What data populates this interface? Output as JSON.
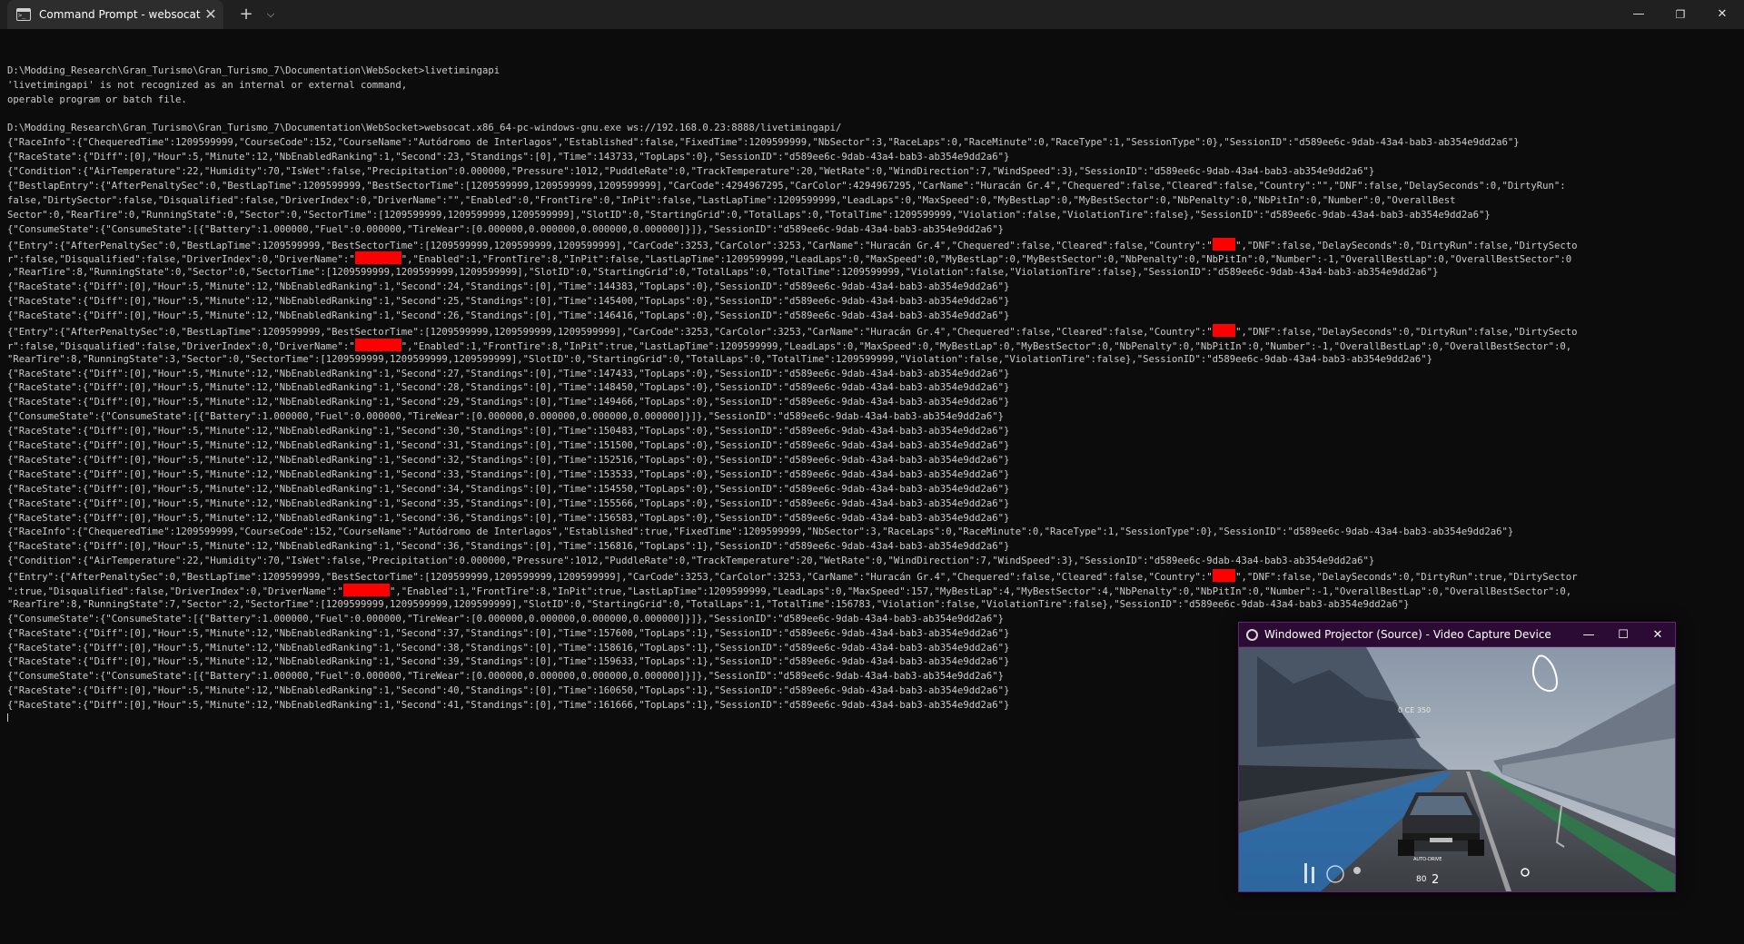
{
  "window": {
    "tab_title": "Command Prompt - websocat",
    "tab_close": "✕",
    "new_tab": "+",
    "dropdown": "⌵",
    "minimize": "—",
    "maximize": "❐",
    "close": "✕"
  },
  "console": {
    "lines": [
      "",
      "D:\\Modding_Research\\Gran_Turismo\\Gran_Turismo_7\\Documentation\\WebSocket>livetimingapi",
      "'livetimingapi' is not recognized as an internal or external command,",
      "operable program or batch file.",
      "",
      "D:\\Modding_Research\\Gran_Turismo\\Gran_Turismo_7\\Documentation\\WebSocket>websocat.x86_64-pc-windows-gnu.exe ws://192.168.0.23:8888/livetimingapi/",
      "{\"RaceInfo\":{\"ChequeredTime\":1209599999,\"CourseCode\":152,\"CourseName\":\"Autódromo de Interlagos\",\"Established\":false,\"FixedTime\":1209599999,\"NbSector\":3,\"RaceLaps\":0,\"RaceMinute\":0,\"RaceType\":1,\"SessionType\":0},\"SessionID\":\"d589ee6c-9dab-43a4-bab3-ab354e9dd2a6\"}",
      "{\"RaceState\":{\"Diff\":[0],\"Hour\":5,\"Minute\":12,\"NbEnabledRanking\":1,\"Second\":23,\"Standings\":[0],\"Time\":143733,\"TopLaps\":0},\"SessionID\":\"d589ee6c-9dab-43a4-bab3-ab354e9dd2a6\"}",
      "{\"Condition\":{\"AirTemperature\":22,\"Humidity\":70,\"IsWet\":false,\"Precipitation\":0.000000,\"Pressure\":1012,\"PuddleRate\":0,\"TrackTemperature\":20,\"WetRate\":0,\"WindDirection\":7,\"WindSpeed\":3},\"SessionID\":\"d589ee6c-9dab-43a4-bab3-ab354e9dd2a6\"}",
      "{\"BestlapEntry\":{\"AfterPenaltySec\":0,\"BestLapTime\":1209599999,\"BestSectorTime\":[1209599999,1209599999,1209599999],\"CarCode\":4294967295,\"CarColor\":4294967295,\"CarName\":\"Huracán Gr.4\",\"Chequered\":false,\"Cleared\":false,\"Country\":\"\",\"DNF\":false,\"DelaySeconds\":0,\"DirtyRun\":",
      "false,\"DirtySector\":false,\"Disqualified\":false,\"DriverIndex\":0,\"DriverName\":\"\",\"Enabled\":0,\"FrontTire\":0,\"InPit\":false,\"LastLapTime\":1209599999,\"LeadLaps\":0,\"MaxSpeed\":0,\"MyBestLap\":0,\"MyBestSector\":0,\"NbPenalty\":0,\"NbPitIn\":0,\"Number\":0,\"OverallBest",
      "Sector\":0,\"RearTire\":0,\"RunningState\":0,\"Sector\":0,\"SectorTime\":[1209599999,1209599999,1209599999],\"SlotID\":0,\"StartingGrid\":0,\"TotalLaps\":0,\"TotalTime\":1209599999,\"Violation\":false,\"ViolationTire\":false},\"SessionID\":\"d589ee6c-9dab-43a4-bab3-ab354e9dd2a6\"}",
      "{\"ConsumeState\":{\"ConsumeState\":[{\"Battery\":1.000000,\"Fuel\":0.000000,\"TireWear\":[0.000000,0.000000,0.000000,0.000000]}]},\"SessionID\":\"d589ee6c-9dab-43a4-bab3-ab354e9dd2a6\"}",
      "{\"Entry\":{\"AfterPenaltySec\":0,\"BestLapTime\":1209599999,\"BestSectorTime\":[1209599999,1209599999,1209599999],\"CarCode\":3253,\"CarColor\":3253,\"CarName\":\"Huracán Gr.4\",\"Chequered\":false,\"Cleared\":false,\"Country\":\"⟦R4⟧\",\"DNF\":false,\"DelaySeconds\":0,\"DirtyRun\":false,\"DirtySecto",
      "r\":false,\"Disqualified\":false,\"DriverIndex\":0,\"DriverName\":\"⟦R8⟧\",\"Enabled\":1,\"FrontTire\":8,\"InPit\":false,\"LastLapTime\":1209599999,\"LeadLaps\":0,\"MaxSpeed\":0,\"MyBestLap\":0,\"MyBestSector\":0,\"NbPenalty\":0,\"NbPitIn\":0,\"Number\":-1,\"OverallBestLap\":0,\"OverallBestSector\":0",
      ",\"RearTire\":8,\"RunningState\":0,\"Sector\":0,\"SectorTime\":[1209599999,1209599999,1209599999],\"SlotID\":0,\"StartingGrid\":0,\"TotalLaps\":0,\"TotalTime\":1209599999,\"Violation\":false,\"ViolationTire\":false},\"SessionID\":\"d589ee6c-9dab-43a4-bab3-ab354e9dd2a6\"}",
      "{\"RaceState\":{\"Diff\":[0],\"Hour\":5,\"Minute\":12,\"NbEnabledRanking\":1,\"Second\":24,\"Standings\":[0],\"Time\":144383,\"TopLaps\":0},\"SessionID\":\"d589ee6c-9dab-43a4-bab3-ab354e9dd2a6\"}",
      "{\"RaceState\":{\"Diff\":[0],\"Hour\":5,\"Minute\":12,\"NbEnabledRanking\":1,\"Second\":25,\"Standings\":[0],\"Time\":145400,\"TopLaps\":0},\"SessionID\":\"d589ee6c-9dab-43a4-bab3-ab354e9dd2a6\"}",
      "{\"RaceState\":{\"Diff\":[0],\"Hour\":5,\"Minute\":12,\"NbEnabledRanking\":1,\"Second\":26,\"Standings\":[0],\"Time\":146416,\"TopLaps\":0},\"SessionID\":\"d589ee6c-9dab-43a4-bab3-ab354e9dd2a6\"}",
      "{\"Entry\":{\"AfterPenaltySec\":0,\"BestLapTime\":1209599999,\"BestSectorTime\":[1209599999,1209599999,1209599999],\"CarCode\":3253,\"CarColor\":3253,\"CarName\":\"Huracán Gr.4\",\"Chequered\":false,\"Cleared\":false,\"Country\":\"⟦R4⟧\",\"DNF\":false,\"DelaySeconds\":0,\"DirtyRun\":false,\"DirtySecto",
      "r\":false,\"Disqualified\":false,\"DriverIndex\":0,\"DriverName\":\"⟦R8⟧\",\"Enabled\":1,\"FrontTire\":8,\"InPit\":true,\"LastLapTime\":1209599999,\"LeadLaps\":0,\"MaxSpeed\":0,\"MyBestLap\":0,\"MyBestSector\":0,\"NbPenalty\":0,\"NbPitIn\":0,\"Number\":-1,\"OverallBestLap\":0,\"OverallBestSector\":0,",
      "\"RearTire\":8,\"RunningState\":3,\"Sector\":0,\"SectorTime\":[1209599999,1209599999,1209599999],\"SlotID\":0,\"StartingGrid\":0,\"TotalLaps\":0,\"TotalTime\":1209599999,\"Violation\":false,\"ViolationTire\":false},\"SessionID\":\"d589ee6c-9dab-43a4-bab3-ab354e9dd2a6\"}",
      "{\"RaceState\":{\"Diff\":[0],\"Hour\":5,\"Minute\":12,\"NbEnabledRanking\":1,\"Second\":27,\"Standings\":[0],\"Time\":147433,\"TopLaps\":0},\"SessionID\":\"d589ee6c-9dab-43a4-bab3-ab354e9dd2a6\"}",
      "{\"RaceState\":{\"Diff\":[0],\"Hour\":5,\"Minute\":12,\"NbEnabledRanking\":1,\"Second\":28,\"Standings\":[0],\"Time\":148450,\"TopLaps\":0},\"SessionID\":\"d589ee6c-9dab-43a4-bab3-ab354e9dd2a6\"}",
      "{\"RaceState\":{\"Diff\":[0],\"Hour\":5,\"Minute\":12,\"NbEnabledRanking\":1,\"Second\":29,\"Standings\":[0],\"Time\":149466,\"TopLaps\":0},\"SessionID\":\"d589ee6c-9dab-43a4-bab3-ab354e9dd2a6\"}",
      "{\"ConsumeState\":{\"ConsumeState\":[{\"Battery\":1.000000,\"Fuel\":0.000000,\"TireWear\":[0.000000,0.000000,0.000000,0.000000]}]},\"SessionID\":\"d589ee6c-9dab-43a4-bab3-ab354e9dd2a6\"}",
      "{\"RaceState\":{\"Diff\":[0],\"Hour\":5,\"Minute\":12,\"NbEnabledRanking\":1,\"Second\":30,\"Standings\":[0],\"Time\":150483,\"TopLaps\":0},\"SessionID\":\"d589ee6c-9dab-43a4-bab3-ab354e9dd2a6\"}",
      "{\"RaceState\":{\"Diff\":[0],\"Hour\":5,\"Minute\":12,\"NbEnabledRanking\":1,\"Second\":31,\"Standings\":[0],\"Time\":151500,\"TopLaps\":0},\"SessionID\":\"d589ee6c-9dab-43a4-bab3-ab354e9dd2a6\"}",
      "{\"RaceState\":{\"Diff\":[0],\"Hour\":5,\"Minute\":12,\"NbEnabledRanking\":1,\"Second\":32,\"Standings\":[0],\"Time\":152516,\"TopLaps\":0},\"SessionID\":\"d589ee6c-9dab-43a4-bab3-ab354e9dd2a6\"}",
      "{\"RaceState\":{\"Diff\":[0],\"Hour\":5,\"Minute\":12,\"NbEnabledRanking\":1,\"Second\":33,\"Standings\":[0],\"Time\":153533,\"TopLaps\":0},\"SessionID\":\"d589ee6c-9dab-43a4-bab3-ab354e9dd2a6\"}",
      "{\"RaceState\":{\"Diff\":[0],\"Hour\":5,\"Minute\":12,\"NbEnabledRanking\":1,\"Second\":34,\"Standings\":[0],\"Time\":154550,\"TopLaps\":0},\"SessionID\":\"d589ee6c-9dab-43a4-bab3-ab354e9dd2a6\"}",
      "{\"RaceState\":{\"Diff\":[0],\"Hour\":5,\"Minute\":12,\"NbEnabledRanking\":1,\"Second\":35,\"Standings\":[0],\"Time\":155566,\"TopLaps\":0},\"SessionID\":\"d589ee6c-9dab-43a4-bab3-ab354e9dd2a6\"}",
      "{\"RaceState\":{\"Diff\":[0],\"Hour\":5,\"Minute\":12,\"NbEnabledRanking\":1,\"Second\":36,\"Standings\":[0],\"Time\":156583,\"TopLaps\":0},\"SessionID\":\"d589ee6c-9dab-43a4-bab3-ab354e9dd2a6\"}",
      "{\"RaceInfo\":{\"ChequeredTime\":1209599999,\"CourseCode\":152,\"CourseName\":\"Autódromo de Interlagos\",\"Established\":true,\"FixedTime\":1209599999,\"NbSector\":3,\"RaceLaps\":0,\"RaceMinute\":0,\"RaceType\":1,\"SessionType\":0},\"SessionID\":\"d589ee6c-9dab-43a4-bab3-ab354e9dd2a6\"}",
      "{\"RaceState\":{\"Diff\":[0],\"Hour\":5,\"Minute\":12,\"NbEnabledRanking\":1,\"Second\":36,\"Standings\":[0],\"Time\":156816,\"TopLaps\":1},\"SessionID\":\"d589ee6c-9dab-43a4-bab3-ab354e9dd2a6\"}",
      "{\"Condition\":{\"AirTemperature\":22,\"Humidity\":70,\"IsWet\":false,\"Precipitation\":0.000000,\"Pressure\":1012,\"PuddleRate\":0,\"TrackTemperature\":20,\"WetRate\":0,\"WindDirection\":7,\"WindSpeed\":3},\"SessionID\":\"d589ee6c-9dab-43a4-bab3-ab354e9dd2a6\"}",
      "{\"Entry\":{\"AfterPenaltySec\":0,\"BestLapTime\":1209599999,\"BestSectorTime\":[1209599999,1209599999,1209599999],\"CarCode\":3253,\"CarColor\":3253,\"CarName\":\"Huracán Gr.4\",\"Chequered\":false,\"Cleared\":false,\"Country\":\"⟦R4⟧\",\"DNF\":false,\"DelaySeconds\":0,\"DirtyRun\":true,\"DirtySector",
      "\":true,\"Disqualified\":false,\"DriverIndex\":0,\"DriverName\":\"⟦R8⟧\",\"Enabled\":1,\"FrontTire\":8,\"InPit\":true,\"LastLapTime\":1209599999,\"LeadLaps\":0,\"MaxSpeed\":157,\"MyBestLap\":4,\"MyBestSector\":4,\"NbPenalty\":0,\"NbPitIn\":0,\"Number\":-1,\"OverallBestLap\":0,\"OverallBestSector\":0,",
      "\"RearTire\":8,\"RunningState\":7,\"Sector\":2,\"SectorTime\":[1209599999,1209599999,1209599999],\"SlotID\":0,\"StartingGrid\":0,\"TotalLaps\":1,\"TotalTime\":156783,\"Violation\":false,\"ViolationTire\":false},\"SessionID\":\"d589ee6c-9dab-43a4-bab3-ab354e9dd2a6\"}",
      "{\"ConsumeState\":{\"ConsumeState\":[{\"Battery\":1.000000,\"Fuel\":0.000000,\"TireWear\":[0.000000,0.000000,0.000000,0.000000]}]},\"SessionID\":\"d589ee6c-9dab-43a4-bab3-ab354e9dd2a6\"}",
      "{\"RaceState\":{\"Diff\":[0],\"Hour\":5,\"Minute\":12,\"NbEnabledRanking\":1,\"Second\":37,\"Standings\":[0],\"Time\":157600,\"TopLaps\":1},\"SessionID\":\"d589ee6c-9dab-43a4-bab3-ab354e9dd2a6\"}",
      "{\"RaceState\":{\"Diff\":[0],\"Hour\":5,\"Minute\":12,\"NbEnabledRanking\":1,\"Second\":38,\"Standings\":[0],\"Time\":158616,\"TopLaps\":1},\"SessionID\":\"d589ee6c-9dab-43a4-bab3-ab354e9dd2a6\"}",
      "{\"RaceState\":{\"Diff\":[0],\"Hour\":5,\"Minute\":12,\"NbEnabledRanking\":1,\"Second\":39,\"Standings\":[0],\"Time\":159633,\"TopLaps\":1},\"SessionID\":\"d589ee6c-9dab-43a4-bab3-ab354e9dd2a6\"}",
      "{\"ConsumeState\":{\"ConsumeState\":[{\"Battery\":1.000000,\"Fuel\":0.000000,\"TireWear\":[0.000000,0.000000,0.000000,0.000000]}]},\"SessionID\":\"d589ee6c-9dab-43a4-bab3-ab354e9dd2a6\"}",
      "{\"RaceState\":{\"Diff\":[0],\"Hour\":5,\"Minute\":12,\"NbEnabledRanking\":1,\"Second\":40,\"Standings\":[0],\"Time\":160650,\"TopLaps\":1},\"SessionID\":\"d589ee6c-9dab-43a4-bab3-ab354e9dd2a6\"}",
      "{\"RaceState\":{\"Diff\":[0],\"Hour\":5,\"Minute\":12,\"NbEnabledRanking\":1,\"Second\":41,\"Standings\":[0],\"Time\":161666,\"TopLaps\":1},\"SessionID\":\"d589ee6c-9dab-43a4-bab3-ab354e9dd2a6\"}"
    ],
    "redaction_color": "#ff0000"
  },
  "projector": {
    "title": "Windowed Projector (Source) - Video Capture Device",
    "minimize": "—",
    "maximize": "☐",
    "close": "✕",
    "hud_speed": "80",
    "hud_gear": "2",
    "hud_mode": "AUTO-DRIVE",
    "hud_distance": "0 CE 350",
    "accent_color": "#6a1f80"
  }
}
